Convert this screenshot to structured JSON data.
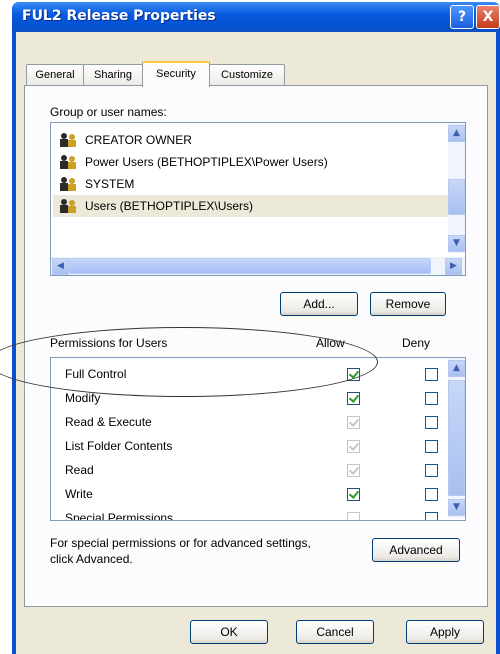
{
  "window": {
    "title": "FUL2 Release Properties",
    "help_glyph": "?",
    "close_glyph": "X"
  },
  "tabs": [
    {
      "label": "General"
    },
    {
      "label": "Sharing"
    },
    {
      "label": "Security"
    },
    {
      "label": "Customize"
    }
  ],
  "users_section": {
    "label": "Group or user names:",
    "items": [
      {
        "label": "CREATOR OWNER"
      },
      {
        "label": "Power Users (BETHOPTIPLEX\\Power Users)"
      },
      {
        "label": "SYSTEM"
      },
      {
        "label": "Users (BETHOPTIPLEX\\Users)"
      }
    ]
  },
  "buttons": {
    "add": "Add...",
    "remove": "Remove",
    "advanced": "Advanced",
    "ok": "OK",
    "cancel": "Cancel",
    "apply": "Apply"
  },
  "permissions": {
    "header": "Permissions for Users",
    "allow_label": "Allow",
    "deny_label": "Deny",
    "rows": [
      {
        "name": "Full Control",
        "allow": true,
        "allow_disabled": false,
        "deny": false
      },
      {
        "name": "Modify",
        "allow": true,
        "allow_disabled": false,
        "deny": false
      },
      {
        "name": "Read & Execute",
        "allow": true,
        "allow_disabled": true,
        "deny": false
      },
      {
        "name": "List Folder Contents",
        "allow": true,
        "allow_disabled": true,
        "deny": false
      },
      {
        "name": "Read",
        "allow": true,
        "allow_disabled": true,
        "deny": false
      },
      {
        "name": "Write",
        "allow": true,
        "allow_disabled": false,
        "deny": false
      },
      {
        "name": "Special Permissions",
        "allow": false,
        "allow_disabled": true,
        "deny": false
      }
    ]
  },
  "advanced_note": {
    "line1": "For special permissions or for advanced settings,",
    "line2": "click Advanced."
  }
}
